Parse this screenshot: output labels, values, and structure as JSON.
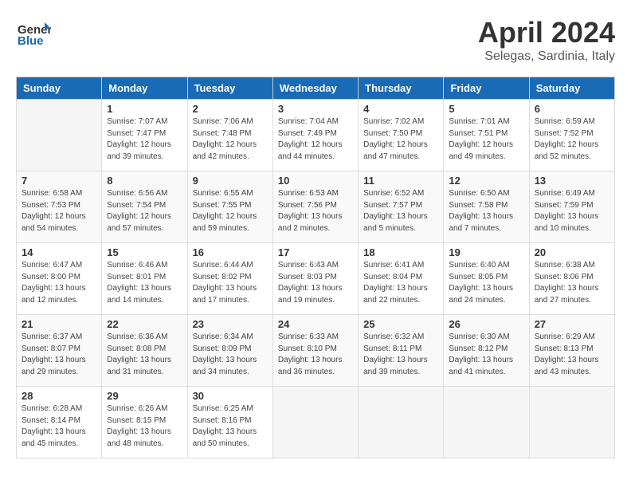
{
  "header": {
    "logo_general": "General",
    "logo_blue": "Blue",
    "month_year": "April 2024",
    "location": "Selegas, Sardinia, Italy"
  },
  "days_of_week": [
    "Sunday",
    "Monday",
    "Tuesday",
    "Wednesday",
    "Thursday",
    "Friday",
    "Saturday"
  ],
  "weeks": [
    [
      {
        "day": "",
        "sunrise": "",
        "sunset": "",
        "daylight": ""
      },
      {
        "day": "1",
        "sunrise": "Sunrise: 7:07 AM",
        "sunset": "Sunset: 7:47 PM",
        "daylight": "Daylight: 12 hours and 39 minutes."
      },
      {
        "day": "2",
        "sunrise": "Sunrise: 7:06 AM",
        "sunset": "Sunset: 7:48 PM",
        "daylight": "Daylight: 12 hours and 42 minutes."
      },
      {
        "day": "3",
        "sunrise": "Sunrise: 7:04 AM",
        "sunset": "Sunset: 7:49 PM",
        "daylight": "Daylight: 12 hours and 44 minutes."
      },
      {
        "day": "4",
        "sunrise": "Sunrise: 7:02 AM",
        "sunset": "Sunset: 7:50 PM",
        "daylight": "Daylight: 12 hours and 47 minutes."
      },
      {
        "day": "5",
        "sunrise": "Sunrise: 7:01 AM",
        "sunset": "Sunset: 7:51 PM",
        "daylight": "Daylight: 12 hours and 49 minutes."
      },
      {
        "day": "6",
        "sunrise": "Sunrise: 6:59 AM",
        "sunset": "Sunset: 7:52 PM",
        "daylight": "Daylight: 12 hours and 52 minutes."
      }
    ],
    [
      {
        "day": "7",
        "sunrise": "Sunrise: 6:58 AM",
        "sunset": "Sunset: 7:53 PM",
        "daylight": "Daylight: 12 hours and 54 minutes."
      },
      {
        "day": "8",
        "sunrise": "Sunrise: 6:56 AM",
        "sunset": "Sunset: 7:54 PM",
        "daylight": "Daylight: 12 hours and 57 minutes."
      },
      {
        "day": "9",
        "sunrise": "Sunrise: 6:55 AM",
        "sunset": "Sunset: 7:55 PM",
        "daylight": "Daylight: 12 hours and 59 minutes."
      },
      {
        "day": "10",
        "sunrise": "Sunrise: 6:53 AM",
        "sunset": "Sunset: 7:56 PM",
        "daylight": "Daylight: 13 hours and 2 minutes."
      },
      {
        "day": "11",
        "sunrise": "Sunrise: 6:52 AM",
        "sunset": "Sunset: 7:57 PM",
        "daylight": "Daylight: 13 hours and 5 minutes."
      },
      {
        "day": "12",
        "sunrise": "Sunrise: 6:50 AM",
        "sunset": "Sunset: 7:58 PM",
        "daylight": "Daylight: 13 hours and 7 minutes."
      },
      {
        "day": "13",
        "sunrise": "Sunrise: 6:49 AM",
        "sunset": "Sunset: 7:59 PM",
        "daylight": "Daylight: 13 hours and 10 minutes."
      }
    ],
    [
      {
        "day": "14",
        "sunrise": "Sunrise: 6:47 AM",
        "sunset": "Sunset: 8:00 PM",
        "daylight": "Daylight: 13 hours and 12 minutes."
      },
      {
        "day": "15",
        "sunrise": "Sunrise: 6:46 AM",
        "sunset": "Sunset: 8:01 PM",
        "daylight": "Daylight: 13 hours and 14 minutes."
      },
      {
        "day": "16",
        "sunrise": "Sunrise: 6:44 AM",
        "sunset": "Sunset: 8:02 PM",
        "daylight": "Daylight: 13 hours and 17 minutes."
      },
      {
        "day": "17",
        "sunrise": "Sunrise: 6:43 AM",
        "sunset": "Sunset: 8:03 PM",
        "daylight": "Daylight: 13 hours and 19 minutes."
      },
      {
        "day": "18",
        "sunrise": "Sunrise: 6:41 AM",
        "sunset": "Sunset: 8:04 PM",
        "daylight": "Daylight: 13 hours and 22 minutes."
      },
      {
        "day": "19",
        "sunrise": "Sunrise: 6:40 AM",
        "sunset": "Sunset: 8:05 PM",
        "daylight": "Daylight: 13 hours and 24 minutes."
      },
      {
        "day": "20",
        "sunrise": "Sunrise: 6:38 AM",
        "sunset": "Sunset: 8:06 PM",
        "daylight": "Daylight: 13 hours and 27 minutes."
      }
    ],
    [
      {
        "day": "21",
        "sunrise": "Sunrise: 6:37 AM",
        "sunset": "Sunset: 8:07 PM",
        "daylight": "Daylight: 13 hours and 29 minutes."
      },
      {
        "day": "22",
        "sunrise": "Sunrise: 6:36 AM",
        "sunset": "Sunset: 8:08 PM",
        "daylight": "Daylight: 13 hours and 31 minutes."
      },
      {
        "day": "23",
        "sunrise": "Sunrise: 6:34 AM",
        "sunset": "Sunset: 8:09 PM",
        "daylight": "Daylight: 13 hours and 34 minutes."
      },
      {
        "day": "24",
        "sunrise": "Sunrise: 6:33 AM",
        "sunset": "Sunset: 8:10 PM",
        "daylight": "Daylight: 13 hours and 36 minutes."
      },
      {
        "day": "25",
        "sunrise": "Sunrise: 6:32 AM",
        "sunset": "Sunset: 8:11 PM",
        "daylight": "Daylight: 13 hours and 39 minutes."
      },
      {
        "day": "26",
        "sunrise": "Sunrise: 6:30 AM",
        "sunset": "Sunset: 8:12 PM",
        "daylight": "Daylight: 13 hours and 41 minutes."
      },
      {
        "day": "27",
        "sunrise": "Sunrise: 6:29 AM",
        "sunset": "Sunset: 8:13 PM",
        "daylight": "Daylight: 13 hours and 43 minutes."
      }
    ],
    [
      {
        "day": "28",
        "sunrise": "Sunrise: 6:28 AM",
        "sunset": "Sunset: 8:14 PM",
        "daylight": "Daylight: 13 hours and 45 minutes."
      },
      {
        "day": "29",
        "sunrise": "Sunrise: 6:26 AM",
        "sunset": "Sunset: 8:15 PM",
        "daylight": "Daylight: 13 hours and 48 minutes."
      },
      {
        "day": "30",
        "sunrise": "Sunrise: 6:25 AM",
        "sunset": "Sunset: 8:16 PM",
        "daylight": "Daylight: 13 hours and 50 minutes."
      },
      {
        "day": "",
        "sunrise": "",
        "sunset": "",
        "daylight": ""
      },
      {
        "day": "",
        "sunrise": "",
        "sunset": "",
        "daylight": ""
      },
      {
        "day": "",
        "sunrise": "",
        "sunset": "",
        "daylight": ""
      },
      {
        "day": "",
        "sunrise": "",
        "sunset": "",
        "daylight": ""
      }
    ]
  ]
}
